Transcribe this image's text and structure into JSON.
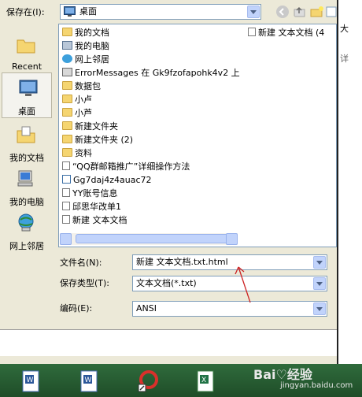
{
  "header": {
    "save_in_label": "保存在(I):",
    "save_in_value": "桌面"
  },
  "places": [
    {
      "label": "Recent",
      "icon": "folder-icon"
    },
    {
      "label": "桌面",
      "icon": "desktop-icon"
    },
    {
      "label": "我的文档",
      "icon": "my-documents-icon"
    },
    {
      "label": "我的电脑",
      "icon": "my-computer-icon"
    },
    {
      "label": "网上邻居",
      "icon": "network-icon"
    }
  ],
  "files": [
    {
      "name": "我的文档",
      "icon": "my-documents-icon"
    },
    {
      "name": "我的电脑",
      "icon": "my-computer-icon"
    },
    {
      "name": "网上邻居",
      "icon": "network-icon"
    },
    {
      "name": "ErrorMessages 在 Gk9fzofapohk4v2 上",
      "icon": "network-share-icon"
    },
    {
      "name": "数据包",
      "icon": "folder-icon"
    },
    {
      "name": "小卢",
      "icon": "folder-icon"
    },
    {
      "name": "小芦",
      "icon": "folder-icon"
    },
    {
      "name": "新建文件夹",
      "icon": "folder-icon"
    },
    {
      "name": "新建文件夹 (2)",
      "icon": "folder-icon"
    },
    {
      "name": "资料",
      "icon": "folder-icon"
    },
    {
      "name": "“QQ群邮箱推广”详细操作方法",
      "icon": "text-doc-icon"
    },
    {
      "name": "Gg7daj4z4auac72",
      "icon": "shortcut-icon"
    },
    {
      "name": "YY账号信息",
      "icon": "text-doc-icon"
    },
    {
      "name": "邱思华改单1",
      "icon": "text-doc-icon"
    },
    {
      "name": "新建 文本文档",
      "icon": "text-doc-icon"
    }
  ],
  "files_col2": [
    {
      "name": "新建 文本文档 (4",
      "icon": "text-doc-icon"
    }
  ],
  "form": {
    "filename_label": "文件名(N):",
    "filename_value": "新建 文本文档.txt.html",
    "filetype_label": "保存类型(T):",
    "filetype_value": "文本文档(*.txt)",
    "encoding_label": "编码(E):",
    "encoding_value": "ANSI"
  },
  "right_panel": {
    "chars": [
      "大",
      "详"
    ]
  },
  "watermark": {
    "main": "Bai♡经验",
    "sub": "jingyan.baidu.com"
  },
  "colors": {
    "dialog_bg": "#ece9d8",
    "field_border": "#7f9db9",
    "annotation_arrow": "#cc2222",
    "taskbar": "#2f6b3c"
  }
}
